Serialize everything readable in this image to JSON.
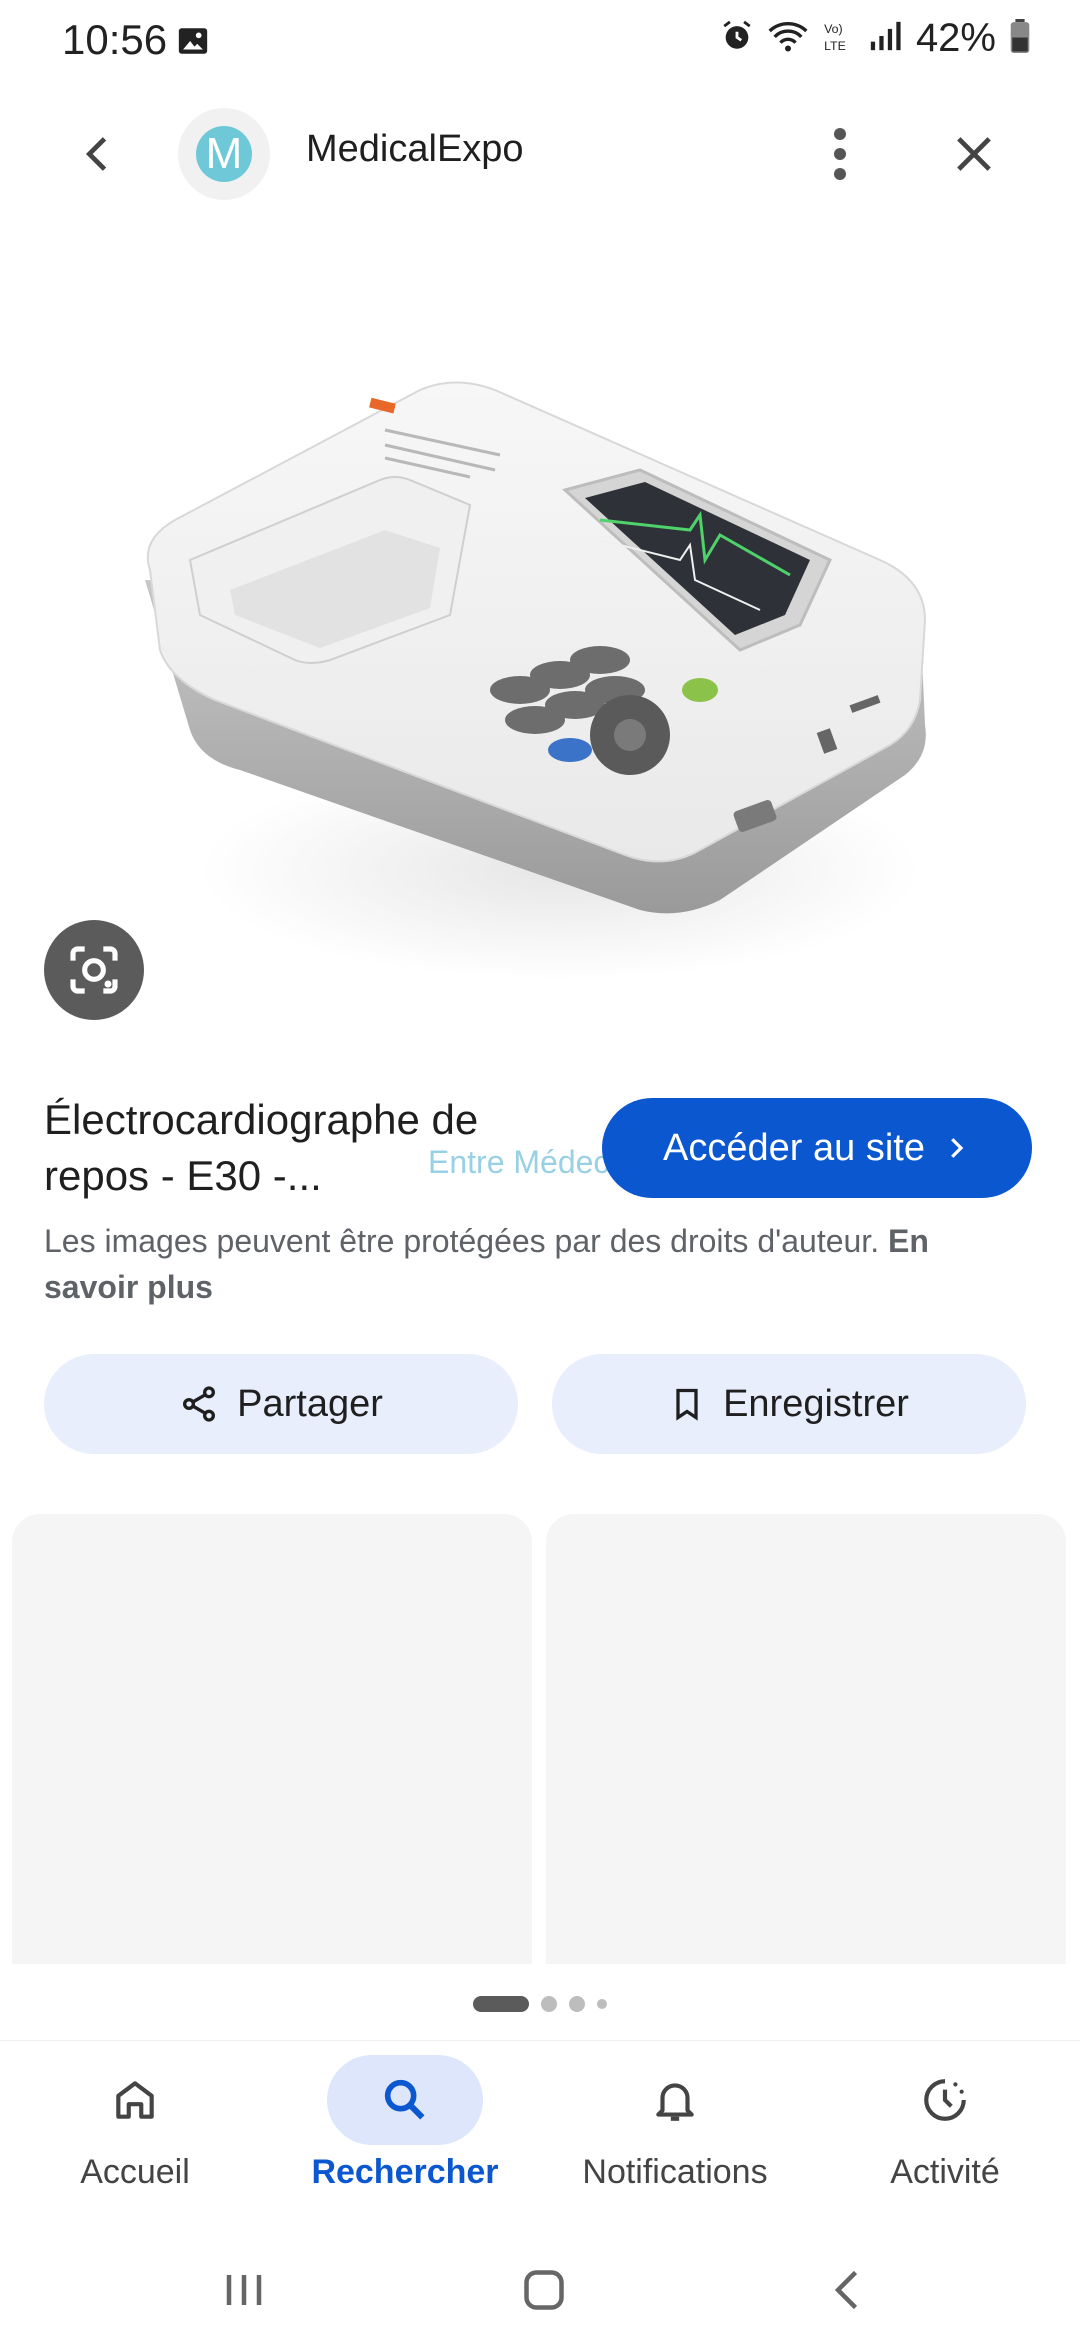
{
  "status": {
    "time": "10:56",
    "battery": "42%"
  },
  "header": {
    "site_name": "MedicalExpo",
    "logo_letter": "M"
  },
  "result": {
    "title": "Électrocardiographe de repos - E30 -...",
    "watermark": "Entre Médecins",
    "visit_button": "Accéder au site",
    "copyright_text": "Les images peuvent être protégées par des droits d'auteur.",
    "learn_more": "En savoir plus"
  },
  "actions": {
    "share": "Partager",
    "save": "Enregistrer"
  },
  "bottom_nav": {
    "items": [
      {
        "label": "Accueil",
        "icon": "home-icon",
        "active": false
      },
      {
        "label": "Rechercher",
        "icon": "search-icon",
        "active": true
      },
      {
        "label": "Notifications",
        "icon": "bell-icon",
        "active": false
      },
      {
        "label": "Activité",
        "icon": "activity-icon",
        "active": false
      }
    ]
  },
  "colors": {
    "accent": "#0b57d0",
    "chip_bg": "#e8eefc"
  }
}
